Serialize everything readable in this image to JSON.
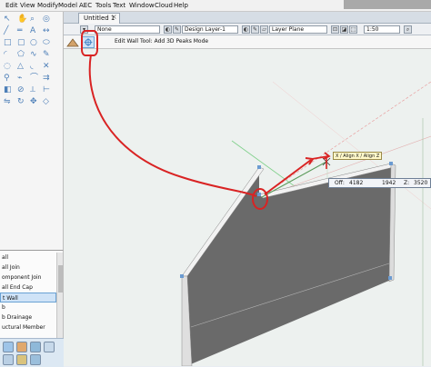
{
  "menu": [
    "Edit",
    "View",
    "Modify",
    "Model",
    "AEC",
    "Tools",
    "Text",
    "Window",
    "Cloud",
    "Help"
  ],
  "document": {
    "tab_label": "Untitled 1",
    "tab_close": "×"
  },
  "view_bar": {
    "class_value": "None",
    "layer_value": "Design Layer-1",
    "plane_value": "Layer Plane",
    "scale_value": "1:50"
  },
  "mode_bar": {
    "hint": "Edit Wall Tool: Add 3D Peaks Mode"
  },
  "resource_list": {
    "items": [
      "all",
      "all Join",
      "omponent Join",
      "all End Cap",
      "t Wall",
      "b",
      "b Drainage",
      "uctural Member"
    ],
    "selected_index": 4
  },
  "tooltip": {
    "align": "X / Align X / Align Z"
  },
  "readout": {
    "offset_label": "Off:",
    "offset_value": "4182",
    "second_value": "1942",
    "z_label": "Z:",
    "z_value": "3520"
  },
  "colors": {
    "annotation": "#d92323",
    "wall_fill": "#6a6a6a",
    "selection": "#cfe3f7"
  }
}
